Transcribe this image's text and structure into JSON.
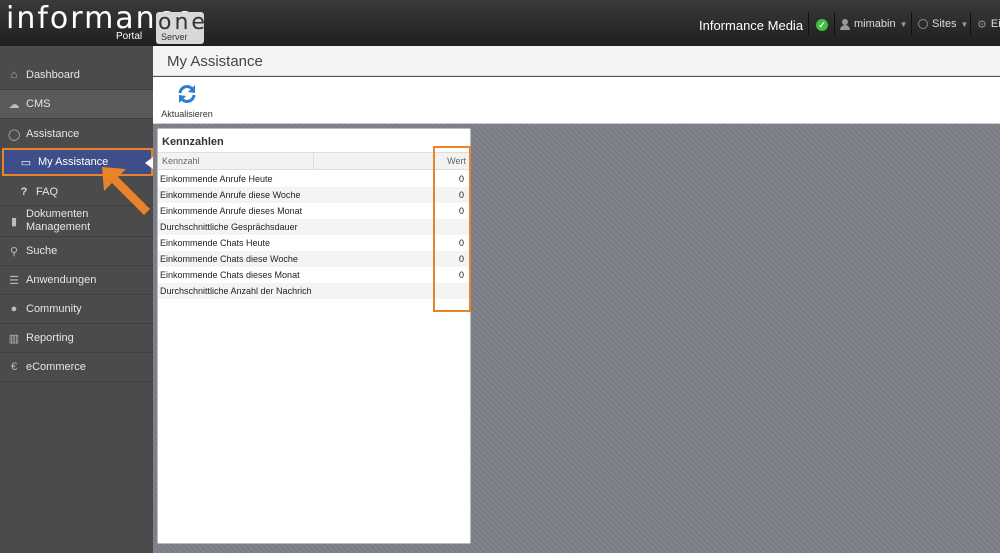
{
  "brand": {
    "name": "informance",
    "suffix": "one",
    "portal": "Portal",
    "server": "Server"
  },
  "header": {
    "org_name": "Informance Media",
    "user_name": "mimabin",
    "sites_label": "Sites",
    "settings_label": "Ei",
    "status_icon": "check-circle-icon"
  },
  "sidebar": {
    "items": [
      {
        "label": "Dashboard",
        "icon": "home-icon"
      },
      {
        "label": "CMS",
        "icon": "cloud-icon"
      },
      {
        "label": "Assistance",
        "icon": "chat-bubble-icon"
      },
      {
        "label": "My Assistance",
        "icon": "monitor-icon"
      },
      {
        "label": "FAQ",
        "icon": "question-icon"
      },
      {
        "label": "Dokumenten Management",
        "icon": "bookmark-icon"
      },
      {
        "label": "Suche",
        "icon": "search-icon"
      },
      {
        "label": "Anwendungen",
        "icon": "list-icon"
      },
      {
        "label": "Community",
        "icon": "user-icon"
      },
      {
        "label": "Reporting",
        "icon": "bar-chart-icon"
      },
      {
        "label": "eCommerce",
        "icon": "euro-icon"
      }
    ],
    "active": "My Assistance"
  },
  "main": {
    "title": "My Assistance",
    "toolbar": {
      "refresh_label": "Aktualisieren"
    },
    "panel": {
      "title": "Kennzahlen",
      "columns": {
        "name": "Kennzahl",
        "value": "Wert"
      },
      "rows": [
        {
          "name": "Einkommende Anrufe Heute",
          "value": "0"
        },
        {
          "name": "Einkommende Anrufe diese Woche",
          "value": "0"
        },
        {
          "name": "Einkommende Anrufe dieses Monat",
          "value": "0"
        },
        {
          "name": "Durchschnittliche Gesprächsdauer",
          "value": ""
        },
        {
          "name": "Einkommende Chats Heute",
          "value": "0"
        },
        {
          "name": "Einkommende Chats diese Woche",
          "value": "0"
        },
        {
          "name": "Einkommende Chats dieses Monat",
          "value": "0"
        },
        {
          "name": "Durchschnittliche Anzahl der Nachrich",
          "value": ""
        }
      ]
    }
  },
  "colors": {
    "accent_orange": "#e8832a",
    "active_nav": "#3d4e8a",
    "status_green": "#3ec03e"
  }
}
